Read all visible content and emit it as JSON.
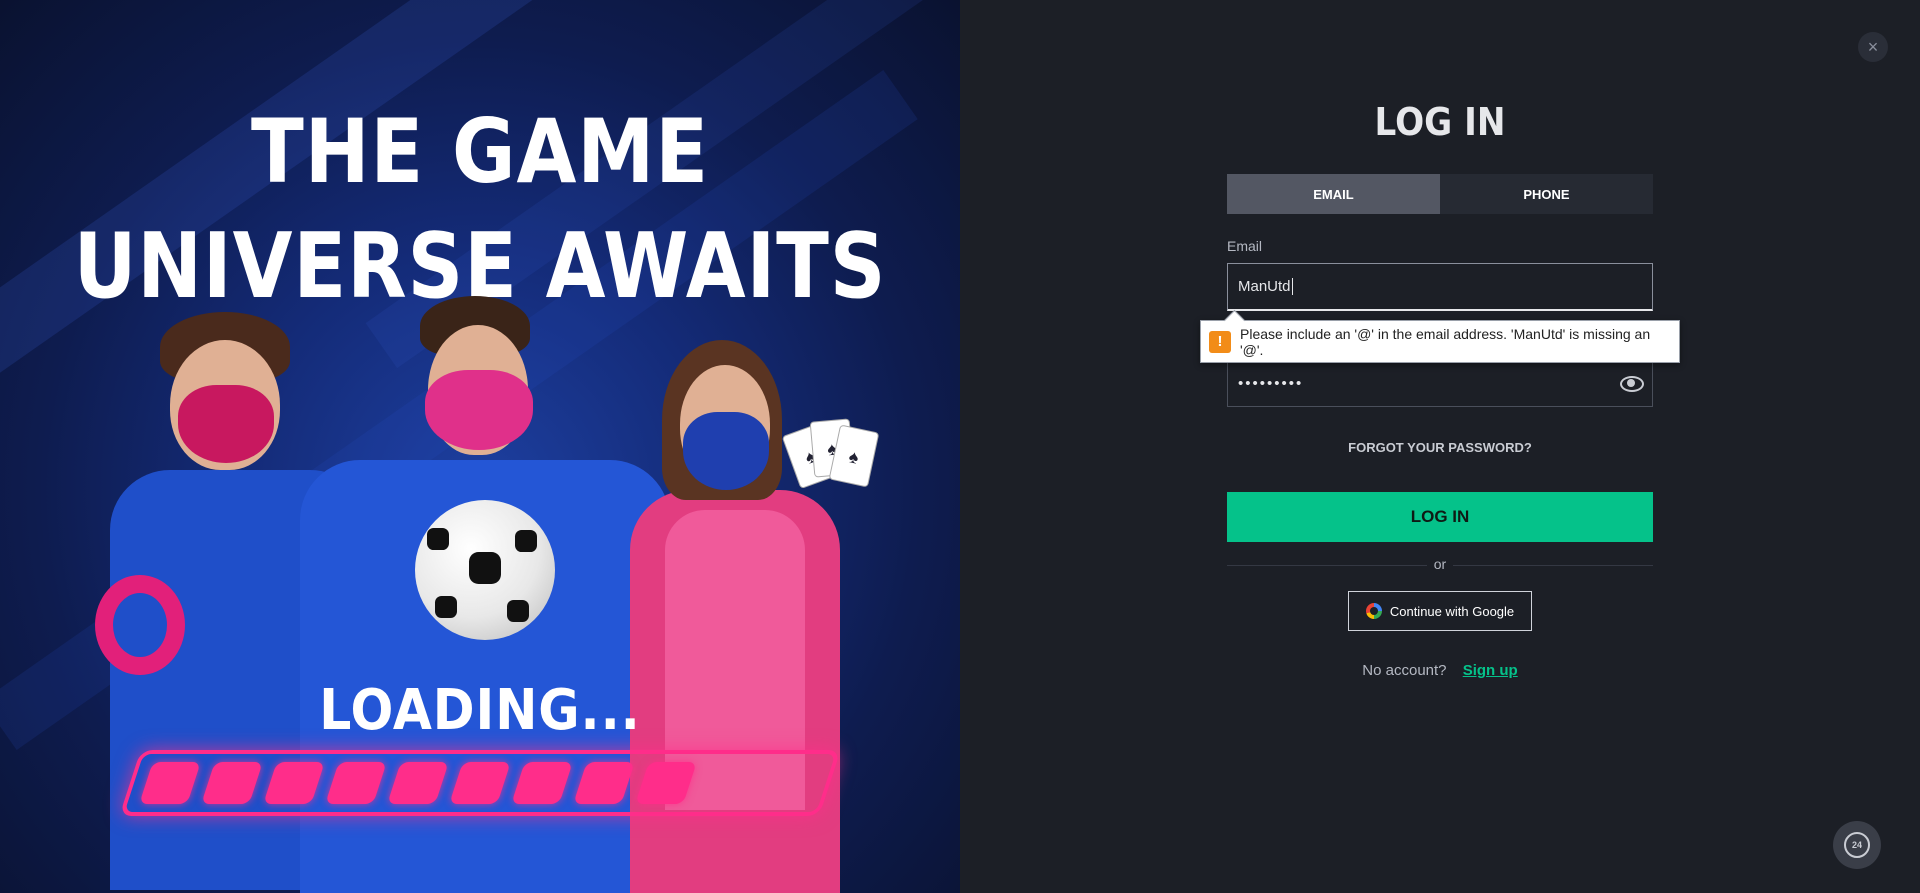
{
  "promo": {
    "headline_line1": "THE GAME",
    "headline_line2": "UNIVERSE AWAITS",
    "loading_text": "LOADING...",
    "loading_segments": 9,
    "accent_color": "#ff2d8a"
  },
  "modal": {
    "close_icon": "×",
    "title": "LOG IN",
    "tabs": [
      {
        "label": "EMAIL",
        "active": true
      },
      {
        "label": "PHONE",
        "active": false
      }
    ],
    "email": {
      "label": "Email",
      "value": "ManUtd"
    },
    "password": {
      "masked_value": "•••••••••",
      "toggle_icon": "eye-icon"
    },
    "validation_tooltip": {
      "icon": "!",
      "message": "Please include an '@' in the email address. 'ManUtd' is missing an '@'."
    },
    "forgot_password": "FORGOT YOUR PASSWORD?",
    "login_button": "LOG IN",
    "divider_text": "or",
    "google_button": "Continue with Google",
    "no_account_text": "No account?",
    "signup_link": "Sign up",
    "primary_color": "#05c28a",
    "support_icon_text": "24"
  }
}
